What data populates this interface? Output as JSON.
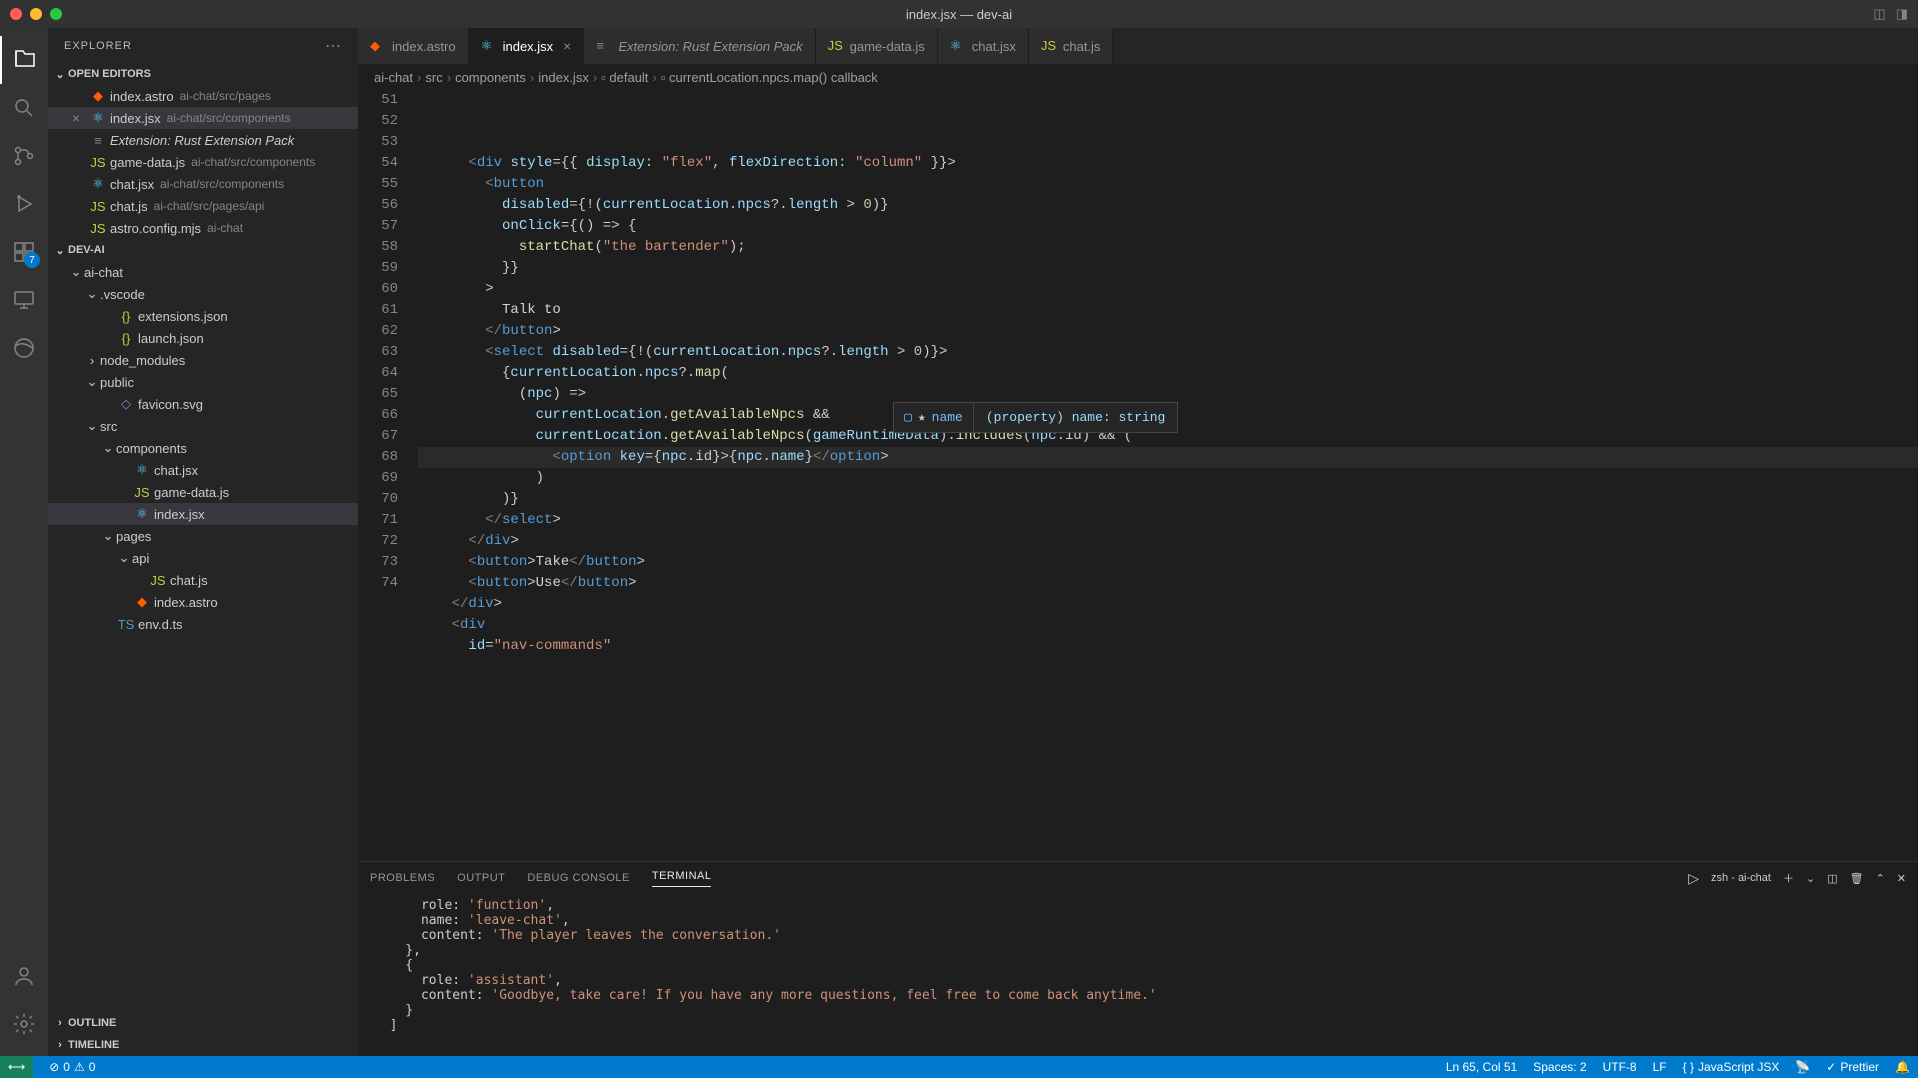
{
  "titlebar": {
    "title": "index.jsx — dev-ai"
  },
  "activity": {
    "badge": "7"
  },
  "sidebar": {
    "title": "EXPLORER",
    "openEditors": {
      "label": "OPEN EDITORS",
      "items": [
        {
          "name": "index.astro",
          "path": "ai-chat/src/pages",
          "icon": "astro"
        },
        {
          "name": "index.jsx",
          "path": "ai-chat/src/components",
          "icon": "react",
          "active": true
        },
        {
          "name": "Extension: Rust Extension Pack",
          "path": "",
          "icon": "ext",
          "italic": true
        },
        {
          "name": "game-data.js",
          "path": "ai-chat/src/components",
          "icon": "js"
        },
        {
          "name": "chat.jsx",
          "path": "ai-chat/src/components",
          "icon": "react"
        },
        {
          "name": "chat.js",
          "path": "ai-chat/src/pages/api",
          "icon": "js"
        },
        {
          "name": "astro.config.mjs",
          "path": "ai-chat",
          "icon": "js"
        }
      ]
    },
    "project": {
      "label": "DEV-AI",
      "tree": [
        {
          "name": "ai-chat",
          "type": "folder",
          "indent": 1,
          "open": true
        },
        {
          "name": ".vscode",
          "type": "folder",
          "indent": 2,
          "open": true
        },
        {
          "name": "extensions.json",
          "type": "file",
          "icon": "json",
          "indent": 3
        },
        {
          "name": "launch.json",
          "type": "file",
          "icon": "json",
          "indent": 3
        },
        {
          "name": "node_modules",
          "type": "folder",
          "indent": 2,
          "open": false
        },
        {
          "name": "public",
          "type": "folder",
          "indent": 2,
          "open": true
        },
        {
          "name": "favicon.svg",
          "type": "file",
          "icon": "svg",
          "indent": 3
        },
        {
          "name": "src",
          "type": "folder",
          "indent": 2,
          "open": true
        },
        {
          "name": "components",
          "type": "folder",
          "indent": 3,
          "open": true
        },
        {
          "name": "chat.jsx",
          "type": "file",
          "icon": "react",
          "indent": 4
        },
        {
          "name": "game-data.js",
          "type": "file",
          "icon": "js",
          "indent": 4
        },
        {
          "name": "index.jsx",
          "type": "file",
          "icon": "react",
          "indent": 4,
          "active": true
        },
        {
          "name": "pages",
          "type": "folder",
          "indent": 3,
          "open": true
        },
        {
          "name": "api",
          "type": "folder",
          "indent": 4,
          "open": true
        },
        {
          "name": "chat.js",
          "type": "file",
          "icon": "js",
          "indent": 5
        },
        {
          "name": "index.astro",
          "type": "file",
          "icon": "astro",
          "indent": 4
        },
        {
          "name": "env.d.ts",
          "type": "file",
          "icon": "ts",
          "indent": 3
        }
      ]
    },
    "outline": "OUTLINE",
    "timeline": "TIMELINE"
  },
  "tabs": [
    {
      "label": "index.astro",
      "icon": "astro"
    },
    {
      "label": "index.jsx",
      "icon": "react",
      "active": true,
      "close": true
    },
    {
      "label": "Extension: Rust Extension Pack",
      "icon": "ext",
      "italic": true
    },
    {
      "label": "game-data.js",
      "icon": "js"
    },
    {
      "label": "chat.jsx",
      "icon": "react"
    },
    {
      "label": "chat.js",
      "icon": "js"
    }
  ],
  "breadcrumbs": [
    "ai-chat",
    "src",
    "components",
    "index.jsx",
    "default",
    "currentLocation.npcs.map() callback"
  ],
  "code": {
    "startLine": 51,
    "lines": [
      "      <div style={{ display: \"flex\", flexDirection: \"column\" }}>",
      "        <button",
      "          disabled={!(currentLocation.npcs?.length > 0)}",
      "          onClick={() => {",
      "            startChat(\"the bartender\");",
      "          }}",
      "        >",
      "          Talk to",
      "        </button>",
      "        <select disabled={!(currentLocation.npcs?.length > 0)}>",
      "          {currentLocation.npcs?.map(",
      "            (npc) =>",
      "              currentLocation.getAvailableNpcs &&",
      "              currentLocation.getAvailableNpcs(gameRuntimeData).includes(npc.id) && (",
      "                <option key={npc.id}>{npc.name}</option>",
      "              )",
      "          )}",
      "        </select>",
      "      </div>",
      "      <button>Take</button>",
      "      <button>Use</button>",
      "    </div>",
      "    <div",
      "      id=\"nav-commands\""
    ]
  },
  "suggest": {
    "item": "name",
    "detail": "(property) name: string",
    "star": "★"
  },
  "panel": {
    "tabs": [
      "PROBLEMS",
      "OUTPUT",
      "DEBUG CONSOLE",
      "TERMINAL"
    ],
    "active": 3,
    "terminalLabel": "zsh - ai-chat",
    "content": "      role: 'function',\n      name: 'leave-chat',\n      content: 'The player leaves the conversation.'\n    },\n    {\n      role: 'assistant',\n      content: 'Goodbye, take care! If you have any more questions, feel free to come back anytime.'\n    }\n  ]"
  },
  "statusbar": {
    "errors": "0",
    "warnings": "0",
    "cursor": "Ln 65, Col 51",
    "spaces": "Spaces: 2",
    "encoding": "UTF-8",
    "eol": "LF",
    "lang": "JavaScript JSX",
    "prettier": "Prettier"
  }
}
